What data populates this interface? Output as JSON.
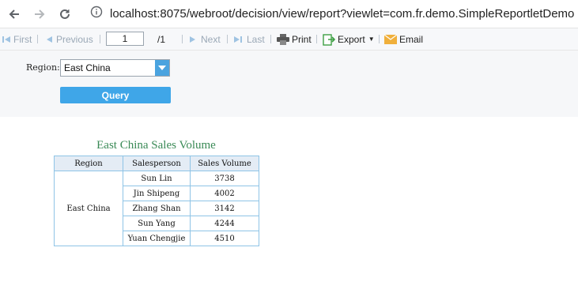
{
  "browser": {
    "url": "localhost:8075/webroot/decision/view/report?viewlet=com.fr.demo.SimpleReportletDemo",
    "back_icon": "back-arrow-icon",
    "forward_icon": "forward-arrow-icon",
    "reload_icon": "reload-icon",
    "info_icon": "info-icon"
  },
  "toolbar": {
    "first": "First",
    "previous": "Previous",
    "page_value": "1",
    "page_total": "/1",
    "next": "Next",
    "last": "Last",
    "print": "Print",
    "export": "Export",
    "email": "Email"
  },
  "params": {
    "region_label": "Region:",
    "region_value": "East China",
    "query_button": "Query"
  },
  "report": {
    "title": "East China Sales Volume",
    "headers": [
      "Region",
      "Salesperson",
      "Sales Volume"
    ],
    "region": "East China",
    "rows": [
      {
        "salesperson": "Sun Lin",
        "volume": "3738"
      },
      {
        "salesperson": "Jin Shipeng",
        "volume": "4002"
      },
      {
        "salesperson": "Zhang Shan",
        "volume": "3142"
      },
      {
        "salesperson": "Sun Yang",
        "volume": "4244"
      },
      {
        "salesperson": "Yuan Chengjie",
        "volume": "4510"
      }
    ]
  },
  "colors": {
    "accent": "#3fa6e8",
    "title_green": "#3a8a56",
    "grid_blue": "#8ec4e6"
  }
}
